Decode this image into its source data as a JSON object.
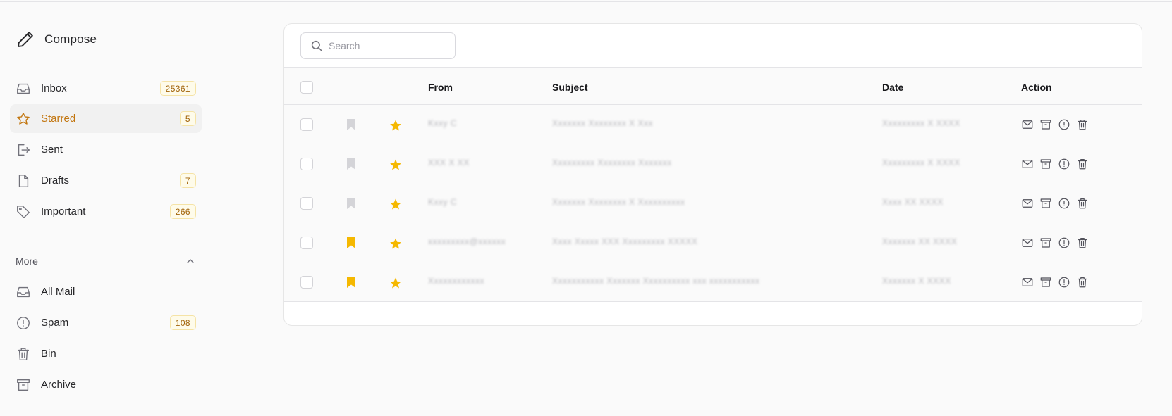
{
  "sidebar": {
    "compose_label": "Compose",
    "items": [
      {
        "label": "Inbox",
        "count": "25361",
        "icon": "inbox-icon"
      },
      {
        "label": "Starred",
        "count": "5",
        "icon": "star-icon",
        "active": true
      },
      {
        "label": "Sent",
        "count": "",
        "icon": "sent-icon"
      },
      {
        "label": "Drafts",
        "count": "7",
        "icon": "draft-icon"
      },
      {
        "label": "Important",
        "count": "266",
        "icon": "tag-icon"
      }
    ],
    "more_label": "More",
    "more_items": [
      {
        "label": "All Mail",
        "count": "",
        "icon": "inbox-icon"
      },
      {
        "label": "Spam",
        "count": "108",
        "icon": "alert-icon"
      },
      {
        "label": "Bin",
        "count": "",
        "icon": "trash-icon"
      },
      {
        "label": "Archive",
        "count": "",
        "icon": "archive-icon"
      }
    ]
  },
  "search": {
    "placeholder": "Search"
  },
  "table": {
    "headers": {
      "from": "From",
      "subject": "Subject",
      "date": "Date",
      "action": "Action"
    },
    "rows": [
      {
        "from": "Kxxy C",
        "subject": "Xxxxxxx Xxxxxxxx X Xxx",
        "date": "Xxxxxxxxx X XXXX",
        "bookmarked": false,
        "starred": true
      },
      {
        "from": "XXX X XX",
        "subject": "Xxxxxxxxx Xxxxxxxx Xxxxxxx",
        "date": "Xxxxxxxxx X XXXX",
        "bookmarked": false,
        "starred": true
      },
      {
        "from": "Kxxy C",
        "subject": "Xxxxxxx Xxxxxxxx X Xxxxxxxxxx",
        "date": "Xxxx XX XXXX",
        "bookmarked": false,
        "starred": true
      },
      {
        "from": "xxxxxxxxx@xxxxxx",
        "subject": "Xxxx Xxxxx XXX Xxxxxxxxx XXXXX",
        "date": "Xxxxxxx XX XXXX",
        "bookmarked": true,
        "starred": true
      },
      {
        "from": "Xxxxxxxxxxxx",
        "subject": "Xxxxxxxxxxx Xxxxxxx Xxxxxxxxxx xxx xxxxxxxxxxx",
        "date": "Xxxxxxx X XXXX",
        "bookmarked": true,
        "starred": true
      }
    ]
  },
  "colors": {
    "accent": "#c2750e",
    "star": "#f5b800",
    "bookmark_active": "#f5b800",
    "bookmark_inactive": "#d4d4d8"
  }
}
